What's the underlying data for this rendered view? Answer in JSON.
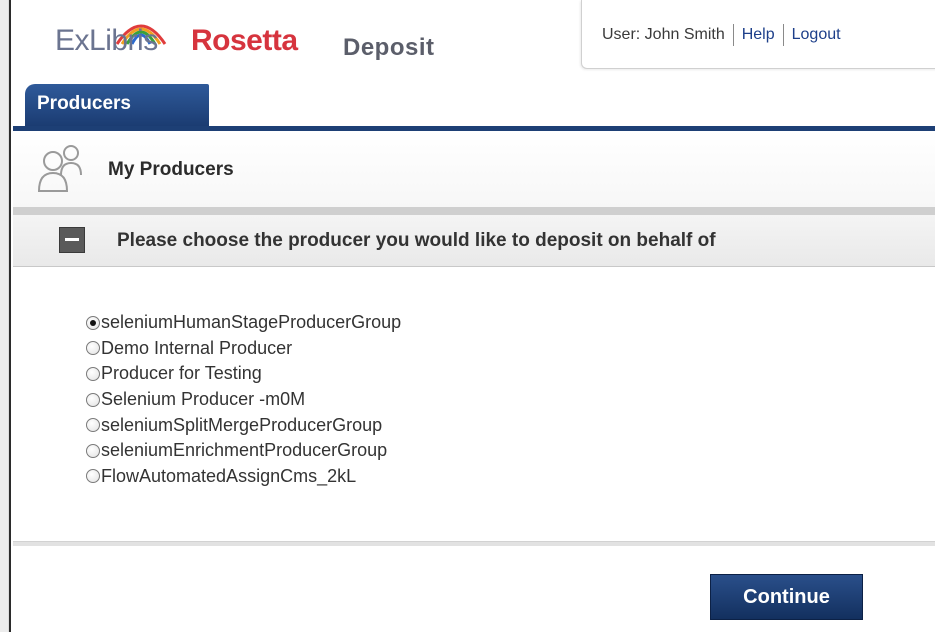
{
  "app": {
    "brand": "ExLibris",
    "product": "Rosetta",
    "module": "Deposit"
  },
  "user_bar": {
    "user_label": "User: John Smith",
    "help_label": "Help",
    "logout_label": "Logout"
  },
  "tabs": [
    {
      "label": "Producers",
      "active": true
    }
  ],
  "page": {
    "title": "My Producers",
    "title_icon": "people-icon"
  },
  "section": {
    "title": "Please choose the producer you would like to deposit on behalf of",
    "collapse_icon": "minus-icon"
  },
  "producers": [
    {
      "label": "seleniumHumanStageProducerGroup",
      "selected": true
    },
    {
      "label": "Demo Internal Producer",
      "selected": false
    },
    {
      "label": "Producer for Testing",
      "selected": false
    },
    {
      "label": "Selenium Producer -m0M",
      "selected": false
    },
    {
      "label": "seleniumSplitMergeProducerGroup",
      "selected": false
    },
    {
      "label": "seleniumEnrichmentProducerGroup",
      "selected": false
    },
    {
      "label": "FlowAutomatedAssignCms_2kL",
      "selected": false
    }
  ],
  "actions": {
    "continue_label": "Continue"
  },
  "colors": {
    "brand_blue": "#1d3f75",
    "brand_red": "#d6343e",
    "brand_gray": "#6b7490"
  }
}
